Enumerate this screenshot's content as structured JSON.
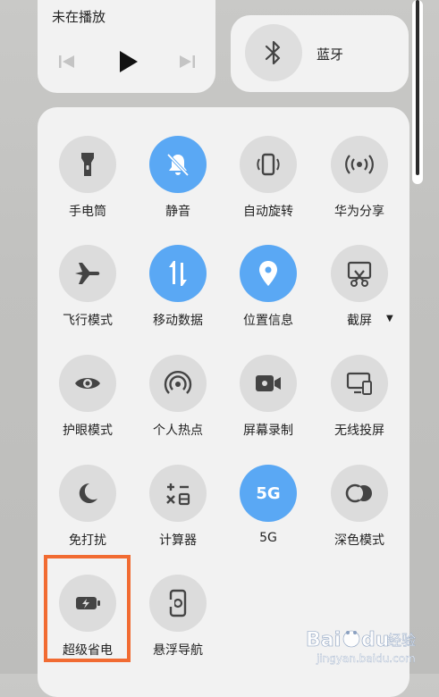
{
  "media": {
    "title": "未在播放"
  },
  "bluetooth": {
    "label": "蓝牙"
  },
  "tiles": [
    {
      "label": "手电筒",
      "icon": "flashlight-icon",
      "active": false
    },
    {
      "label": "静音",
      "icon": "bell-mute-icon",
      "active": true
    },
    {
      "label": "自动旋转",
      "icon": "auto-rotate-icon",
      "active": false
    },
    {
      "label": "华为分享",
      "icon": "huawei-share-icon",
      "active": false
    },
    {
      "label": "飞行模式",
      "icon": "airplane-icon",
      "active": false
    },
    {
      "label": "移动数据",
      "icon": "mobile-data-icon",
      "active": true
    },
    {
      "label": "位置信息",
      "icon": "location-icon",
      "active": true
    },
    {
      "label": "截屏",
      "icon": "screenshot-icon",
      "active": false
    },
    {
      "label": "护眼模式",
      "icon": "eye-icon",
      "active": false
    },
    {
      "label": "个人热点",
      "icon": "hotspot-icon",
      "active": false
    },
    {
      "label": "屏幕录制",
      "icon": "screen-record-icon",
      "active": false
    },
    {
      "label": "无线投屏",
      "icon": "wireless-projection-icon",
      "active": false
    },
    {
      "label": "免打扰",
      "icon": "moon-icon",
      "active": false
    },
    {
      "label": "计算器",
      "icon": "calculator-icon",
      "active": false
    },
    {
      "label": "5G",
      "icon": "5g-icon",
      "active": true,
      "glyph": "5G"
    },
    {
      "label": "深色模式",
      "icon": "dark-mode-icon",
      "active": false
    },
    {
      "label": "超级省电",
      "icon": "battery-saver-icon",
      "active": false
    },
    {
      "label": "悬浮导航",
      "icon": "floating-nav-icon",
      "active": false
    }
  ],
  "colors": {
    "active": "#5aa8f4",
    "highlight": "#f16b32"
  },
  "watermark": {
    "brand": "Bai",
    "brand2": "du",
    "suffix": "经验",
    "url": "jingyan.baidu.com"
  }
}
